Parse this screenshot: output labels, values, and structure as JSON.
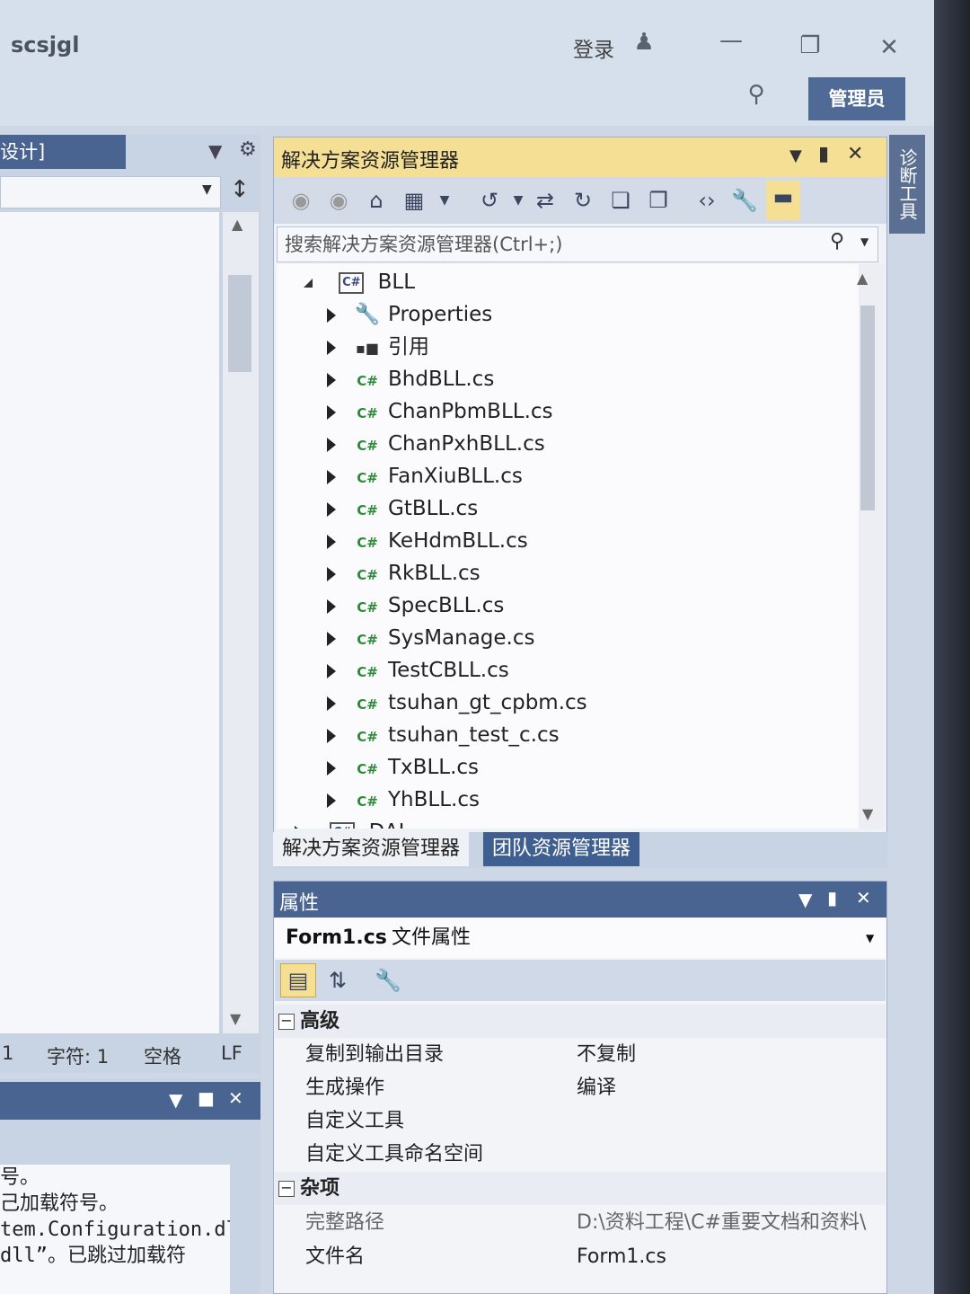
{
  "titlebar": {
    "app_title": "scsjgl",
    "login_label": "登录",
    "admin_label": "管理员"
  },
  "left_panel": {
    "tab_label": "设计]",
    "status": {
      "line": "1",
      "char": "字符: 1",
      "spaces": "空格",
      "eol": "LF"
    }
  },
  "output": {
    "lines": [
      "号。",
      "己加载符号。",
      "tem.Configuration.dl",
      "dll”。已跳过加载符"
    ]
  },
  "solution_explorer": {
    "title": "解决方案资源管理器",
    "search_placeholder": "搜索解决方案资源管理器(Ctrl+;)",
    "project_name": "BLL",
    "items": [
      {
        "label": "Properties",
        "icon": "wrench-icon"
      },
      {
        "label": "引用",
        "icon": "references-icon"
      },
      {
        "label": "BhdBLL.cs",
        "icon": "csharp-file-icon"
      },
      {
        "label": "ChanPbmBLL.cs",
        "icon": "csharp-file-icon"
      },
      {
        "label": "ChanPxhBLL.cs",
        "icon": "csharp-file-icon"
      },
      {
        "label": "FanXiuBLL.cs",
        "icon": "csharp-file-icon"
      },
      {
        "label": "GtBLL.cs",
        "icon": "csharp-file-icon"
      },
      {
        "label": "KeHdmBLL.cs",
        "icon": "csharp-file-icon"
      },
      {
        "label": "RkBLL.cs",
        "icon": "csharp-file-icon"
      },
      {
        "label": "SpecBLL.cs",
        "icon": "csharp-file-icon"
      },
      {
        "label": "SysManage.cs",
        "icon": "csharp-file-icon"
      },
      {
        "label": "TestCBLL.cs",
        "icon": "csharp-file-icon"
      },
      {
        "label": "tsuhan_gt_cpbm.cs",
        "icon": "csharp-file-icon"
      },
      {
        "label": "tsuhan_test_c.cs",
        "icon": "csharp-file-icon"
      },
      {
        "label": "TxBLL.cs",
        "icon": "csharp-file-icon"
      },
      {
        "label": "YhBLL.cs",
        "icon": "csharp-file-icon"
      }
    ],
    "next_project": "DAL",
    "tabs": [
      "解决方案资源管理器",
      "团队资源管理器"
    ]
  },
  "properties": {
    "title": "属性",
    "object_name": "Form1.cs",
    "object_type": "文件属性",
    "categories": [
      {
        "name": "高级",
        "rows": [
          {
            "name": "复制到输出目录",
            "value": "不复制"
          },
          {
            "name": "生成操作",
            "value": "编译"
          },
          {
            "name": "自定义工具",
            "value": ""
          },
          {
            "name": "自定义工具命名空间",
            "value": ""
          }
        ]
      },
      {
        "name": "杂项",
        "rows": [
          {
            "name": "完整路径",
            "value": "D:\\资料工程\\C#重要文档和资料\\"
          },
          {
            "name": "文件名",
            "value": "Form1.cs"
          }
        ]
      }
    ]
  },
  "diagnostics_tab": "诊断工具",
  "colors": {
    "accent_header": "#f5df95",
    "panel_blue": "#4a6491",
    "team_tab": "#3f5f91"
  }
}
